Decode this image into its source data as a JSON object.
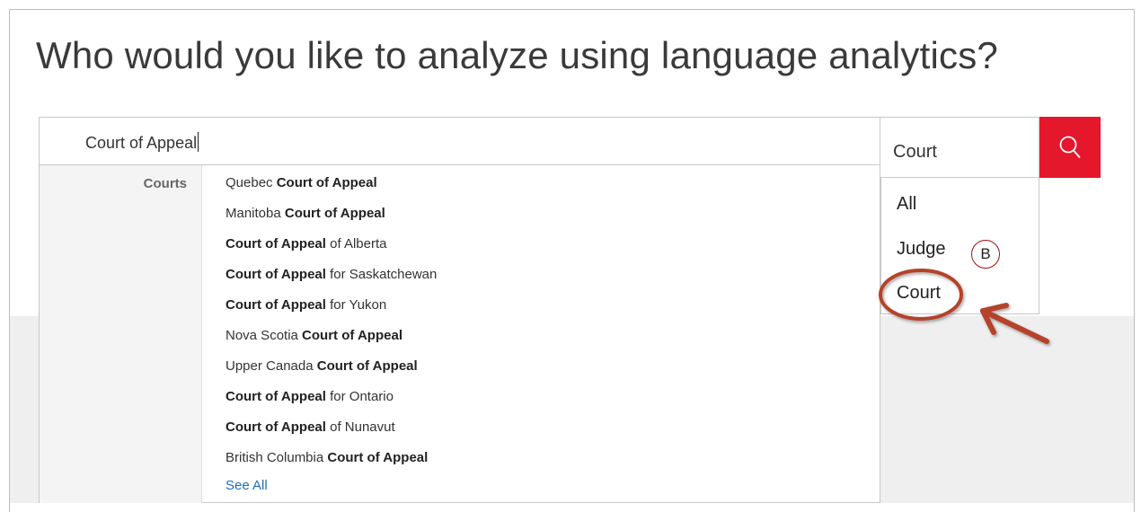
{
  "heading": "Who would you like to analyze using language analytics?",
  "search": {
    "value": "Court of Appeal"
  },
  "type_select": {
    "value": "Court",
    "options": [
      "All",
      "Judge",
      "Court"
    ]
  },
  "suggestions": {
    "category": "Courts",
    "items": [
      {
        "pre": "Quebec ",
        "bold": "Court of Appeal",
        "post": ""
      },
      {
        "pre": "Manitoba ",
        "bold": "Court of Appeal",
        "post": ""
      },
      {
        "pre": "",
        "bold": "Court of Appeal",
        "post": " of Alberta"
      },
      {
        "pre": "",
        "bold": "Court of Appeal",
        "post": " for Saskatchewan"
      },
      {
        "pre": "",
        "bold": "Court of Appeal",
        "post": " for Yukon"
      },
      {
        "pre": "Nova Scotia ",
        "bold": "Court of Appeal",
        "post": ""
      },
      {
        "pre": "Upper Canada ",
        "bold": "Court of Appeal",
        "post": ""
      },
      {
        "pre": "",
        "bold": "Court of Appeal",
        "post": " for Ontario"
      },
      {
        "pre": "",
        "bold": "Court of Appeal",
        "post": " of Nunavut"
      },
      {
        "pre": "British Columbia ",
        "bold": "Court of Appeal",
        "post": ""
      }
    ],
    "see_all": "See All"
  },
  "annotation": {
    "badge": "B",
    "color": "#b5432a"
  },
  "colors": {
    "accent": "#e5172c",
    "link": "#1f6fb8"
  },
  "icons": {
    "search_button": "search-icon"
  }
}
